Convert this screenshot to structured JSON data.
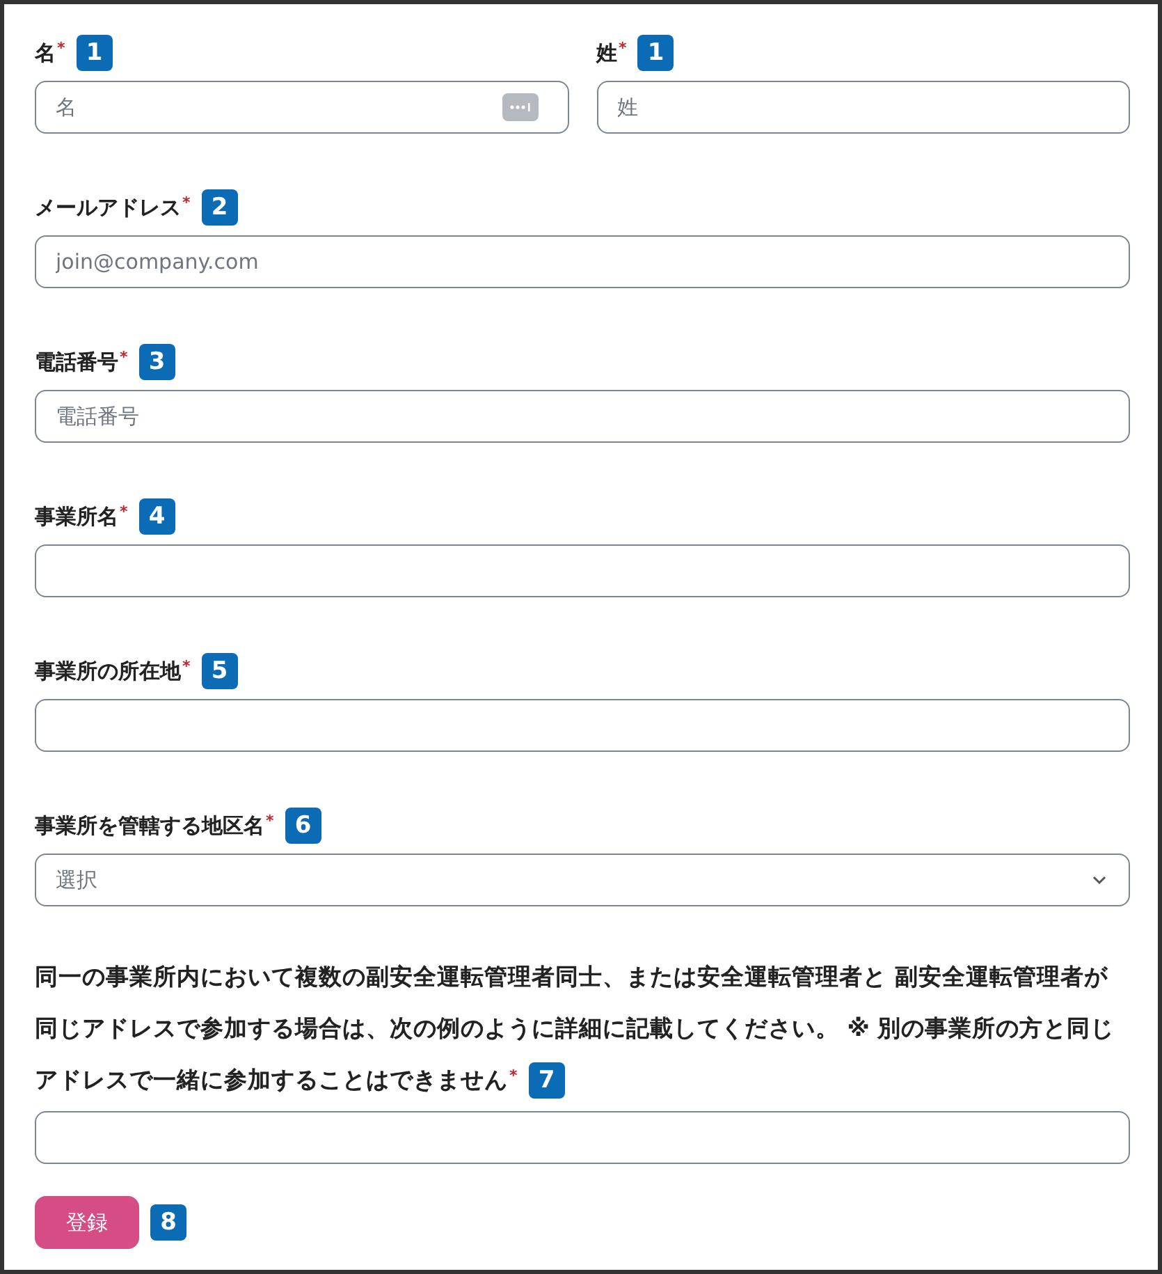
{
  "rows": [
    {
      "fields": [
        {
          "kind": "text",
          "label": "名",
          "required_mark": "*",
          "badge": "1",
          "placeholder": "名",
          "autofill_icon": true
        },
        {
          "kind": "text",
          "label": "姓",
          "required_mark": "*",
          "badge": "1",
          "placeholder": "姓"
        }
      ]
    },
    {
      "fields": [
        {
          "kind": "text",
          "label": "メールアドレス",
          "required_mark": "*",
          "badge": "2",
          "placeholder": "join@company.com"
        }
      ]
    },
    {
      "fields": [
        {
          "kind": "text",
          "label": "電話番号",
          "required_mark": "*",
          "badge": "3",
          "placeholder": "電話番号"
        }
      ]
    },
    {
      "fields": [
        {
          "kind": "text",
          "label": "事業所名",
          "required_mark": "*",
          "badge": "4"
        }
      ]
    },
    {
      "fields": [
        {
          "kind": "text",
          "label": "事業所の所在地",
          "required_mark": "*",
          "badge": "5"
        }
      ]
    },
    {
      "fields": [
        {
          "kind": "select",
          "label": "事業所を管轄する地区名",
          "required_mark": "*",
          "badge": "6",
          "placeholder": "選択"
        }
      ]
    },
    {
      "fields": [
        {
          "kind": "long",
          "label_lines": [
            "同一の事業所内において複数の副安全運転管理者同士、または安全運転管理者と 副安全運転管理者が",
            "同じアドレスで参加する場合は、次の例のように詳細に記載してください。 ※ 別の事業所の方と同じ",
            "アドレスで一緒に参加することはできません"
          ],
          "required_mark": "*",
          "badge": "7"
        }
      ]
    }
  ],
  "submit": {
    "label": "登録",
    "badge": "8"
  }
}
